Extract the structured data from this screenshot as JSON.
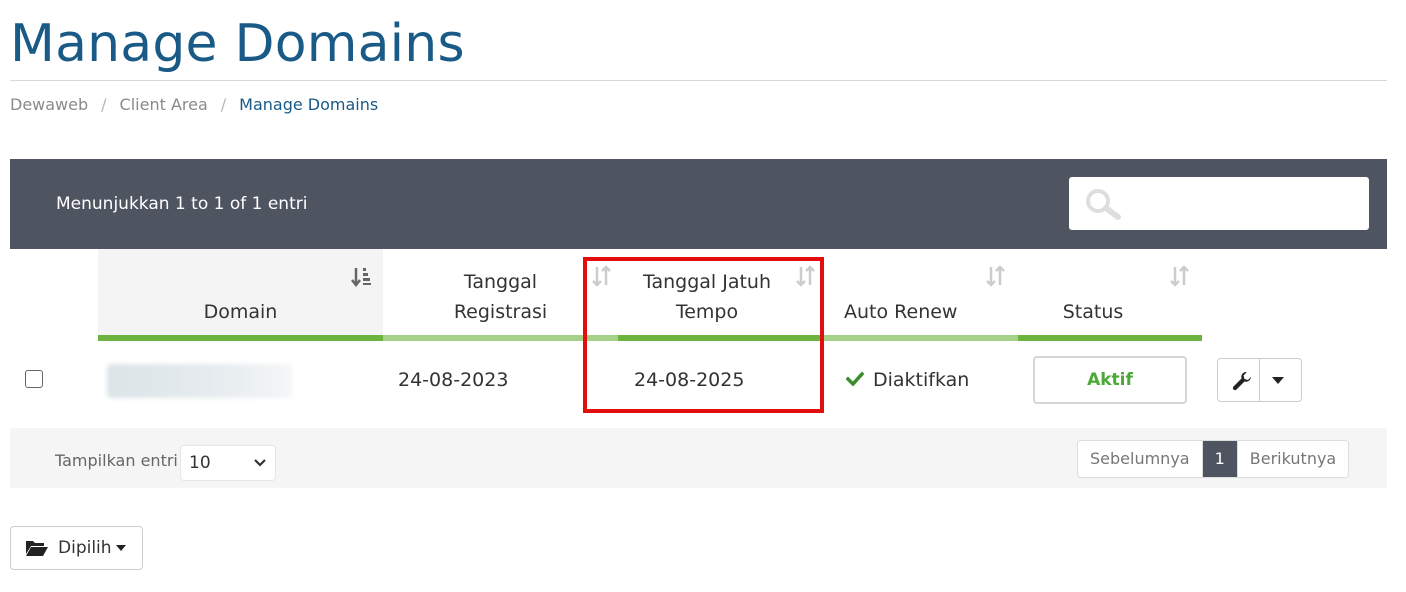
{
  "page": {
    "title": "Manage Domains"
  },
  "breadcrumb": {
    "items": [
      "Dewaweb",
      "Client Area",
      "Manage Domains"
    ]
  },
  "table": {
    "info": "Menunjukkan 1 to 1 of 1 entri",
    "search_placeholder": "",
    "columns": [
      "Domain",
      "Tanggal\nRegistrasi",
      "Tanggal Jatuh\nTempo",
      "Auto Renew",
      "Status"
    ],
    "rows": [
      {
        "domain": "",
        "registered": "24-08-2023",
        "due": "24-08-2025",
        "auto_renew": "Diaktifkan",
        "status": "Aktif"
      }
    ]
  },
  "footer": {
    "length_label": "Tampilkan entri",
    "length_value": "10",
    "pagination": {
      "prev": "Sebelumnya",
      "current": "1",
      "next": "Berikutnya"
    }
  },
  "bulk": {
    "label": "Dipilih"
  },
  "colors": {
    "brand": "#1a5a86",
    "header_bar": "#4f5461",
    "accent_green": "#6db33f",
    "status_green": "#4aaa35",
    "highlight": "#e30d0d"
  },
  "icons": [
    "search-icon",
    "sort-asc-icon",
    "sort-icon",
    "check-icon",
    "wrench-icon",
    "caret-down-icon",
    "chevron-down-icon",
    "folder-open-icon"
  ]
}
